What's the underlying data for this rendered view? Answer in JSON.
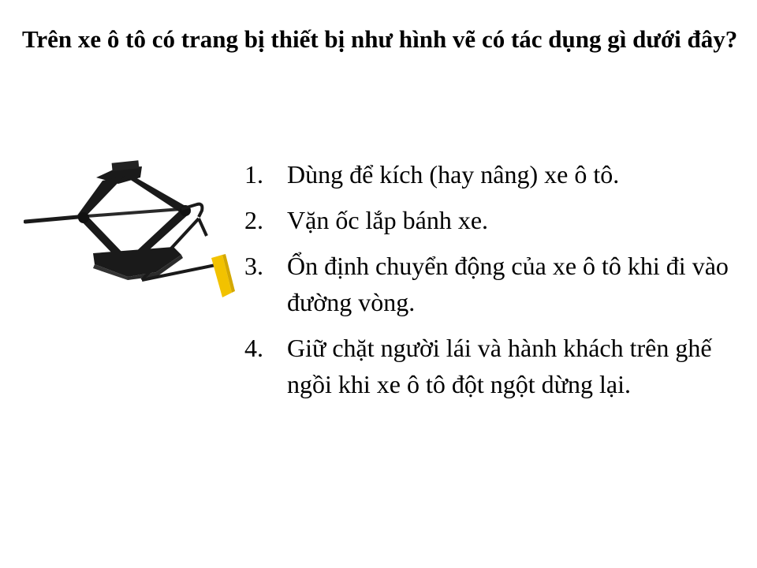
{
  "question": {
    "text": "Trên xe ô tô có trang bị thiết bị như hình vẽ có tác dụng gì dưới đây?"
  },
  "figure": {
    "icon": "car-scissor-jack-icon",
    "colors": {
      "jack": "#1a1a1a",
      "handle_grip": "#f2c200"
    }
  },
  "answers": [
    {
      "number": "1.",
      "text": "Dùng để kích (hay nâng) xe ô tô."
    },
    {
      "number": "2.",
      "text": "Vặn ốc lắp bánh xe."
    },
    {
      "number": "3.",
      "text": "Ổn định chuyển động của xe ô tô khi đi vào đường vòng."
    },
    {
      "number": "4.",
      "text": "Giữ chặt người lái và hành khách trên ghế ngồi khi xe ô tô đột ngột dừng lại."
    }
  ]
}
